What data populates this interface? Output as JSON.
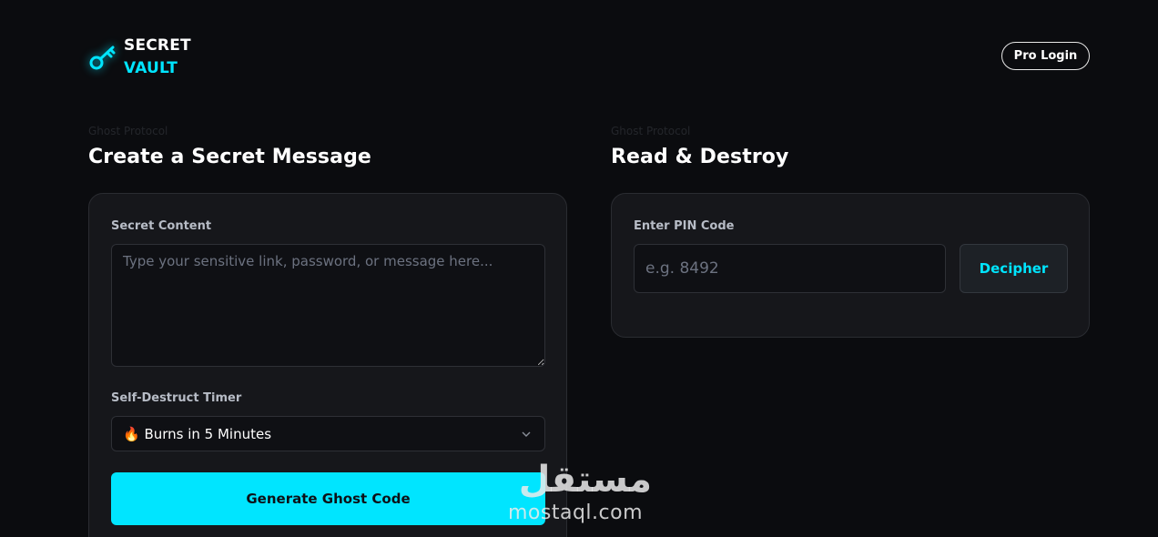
{
  "header": {
    "brand_line1": "SECRET",
    "brand_line2": "VAULT",
    "brand_icon": "key-icon",
    "pro_login_label": "Pro Login"
  },
  "create": {
    "eyebrow": "Ghost Protocol",
    "title": "Create a Secret Message",
    "content_label": "Secret Content",
    "content_placeholder": "Type your sensitive link, password, or message here...",
    "content_value": "",
    "timer_label": "Self-Destruct Timer",
    "timer_selected": "🔥 Burns in 5 Minutes",
    "generate_label": "Generate Ghost Code"
  },
  "read": {
    "eyebrow": "Ghost Protocol",
    "title": "Read & Destroy",
    "pin_label": "Enter PIN Code",
    "pin_placeholder": "e.g. 8492",
    "pin_value": "",
    "decipher_label": "Decipher"
  },
  "watermark": {
    "arabic": "مستقل",
    "latin": "mostaql.com"
  },
  "colors": {
    "background": "#0b0c0f",
    "card": "#16171b",
    "accent": "#00e5ff",
    "label": "#b7bcc6",
    "placeholder": "#6c7280"
  }
}
